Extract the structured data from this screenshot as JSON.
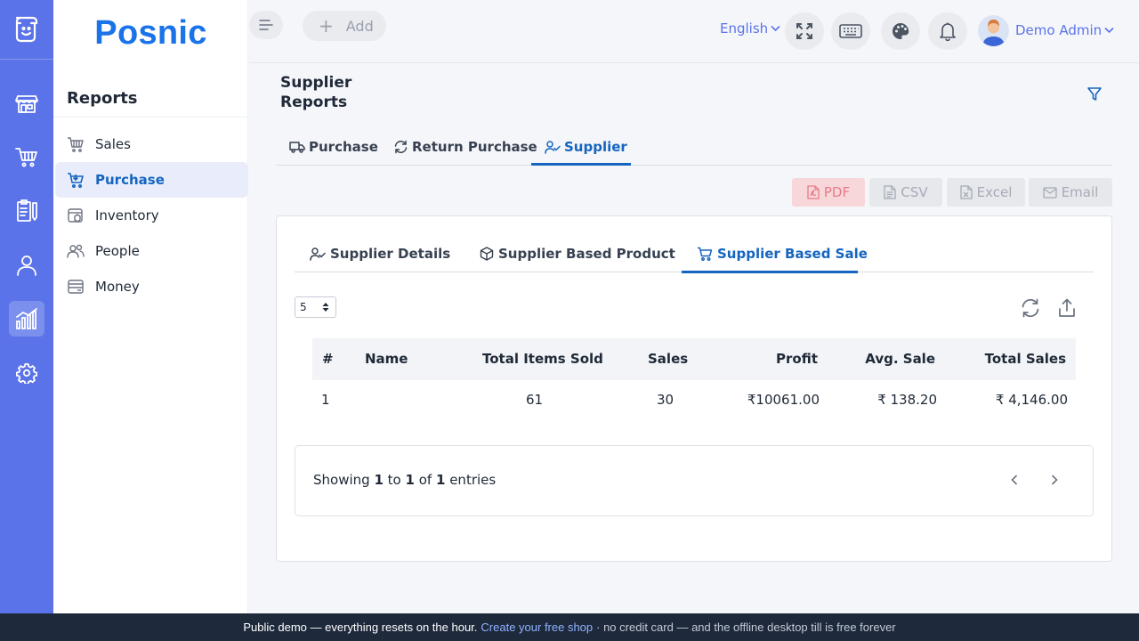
{
  "brand": {
    "name": "Posnic"
  },
  "sidebar": {
    "title": "Reports",
    "items": [
      {
        "label": "Sales",
        "icon": "basket-icon"
      },
      {
        "label": "Purchase",
        "icon": "cart-icon",
        "active": true
      },
      {
        "label": "Inventory",
        "icon": "box-icon"
      },
      {
        "label": "People",
        "icon": "people-icon"
      },
      {
        "label": "Money",
        "icon": "money-icon"
      }
    ]
  },
  "rail": {
    "icons": [
      "store-icon",
      "cart-icon",
      "clipboard-icon",
      "user-icon",
      "chart-icon",
      "gear-icon"
    ],
    "active_index": 4
  },
  "topbar": {
    "add_label": "Add",
    "language": "English",
    "user_name": "Demo Admin"
  },
  "page": {
    "title": "Supplier Reports",
    "tabs": [
      {
        "label": "Purchase"
      },
      {
        "label": "Return Purchase"
      },
      {
        "label": "Supplier",
        "active": true
      }
    ],
    "exports": [
      "PDF",
      "CSV",
      "Excel",
      "Email"
    ]
  },
  "card": {
    "tabs": [
      {
        "label": "Supplier Details"
      },
      {
        "label": "Supplier Based Product"
      },
      {
        "label": "Supplier Based Sale",
        "active": true
      }
    ],
    "page_size": "5",
    "table": {
      "headers": [
        "#",
        "Name",
        "Total Items Sold",
        "Sales",
        "Profit",
        "Avg. Sale",
        "Total Sales"
      ],
      "rows": [
        [
          "1",
          "",
          "61",
          "30",
          "₹10061.00",
          "₹ 138.20",
          "₹ 4,146.00"
        ]
      ]
    },
    "pager": {
      "prefix": "Showing",
      "from": "1",
      "to_word": "to",
      "to": "1",
      "of_word": "of",
      "total": "1",
      "suffix": "entries"
    }
  },
  "banner": {
    "text": "Public demo — everything resets on the hour.",
    "link": "Create your free shop",
    "tail": "· no credit card — and the offline desktop till is free forever"
  },
  "colors": {
    "rail": "#5b73e8",
    "accent": "#1565c0",
    "brand": "#1a73e8",
    "pdf_bg": "#f8d7da"
  }
}
